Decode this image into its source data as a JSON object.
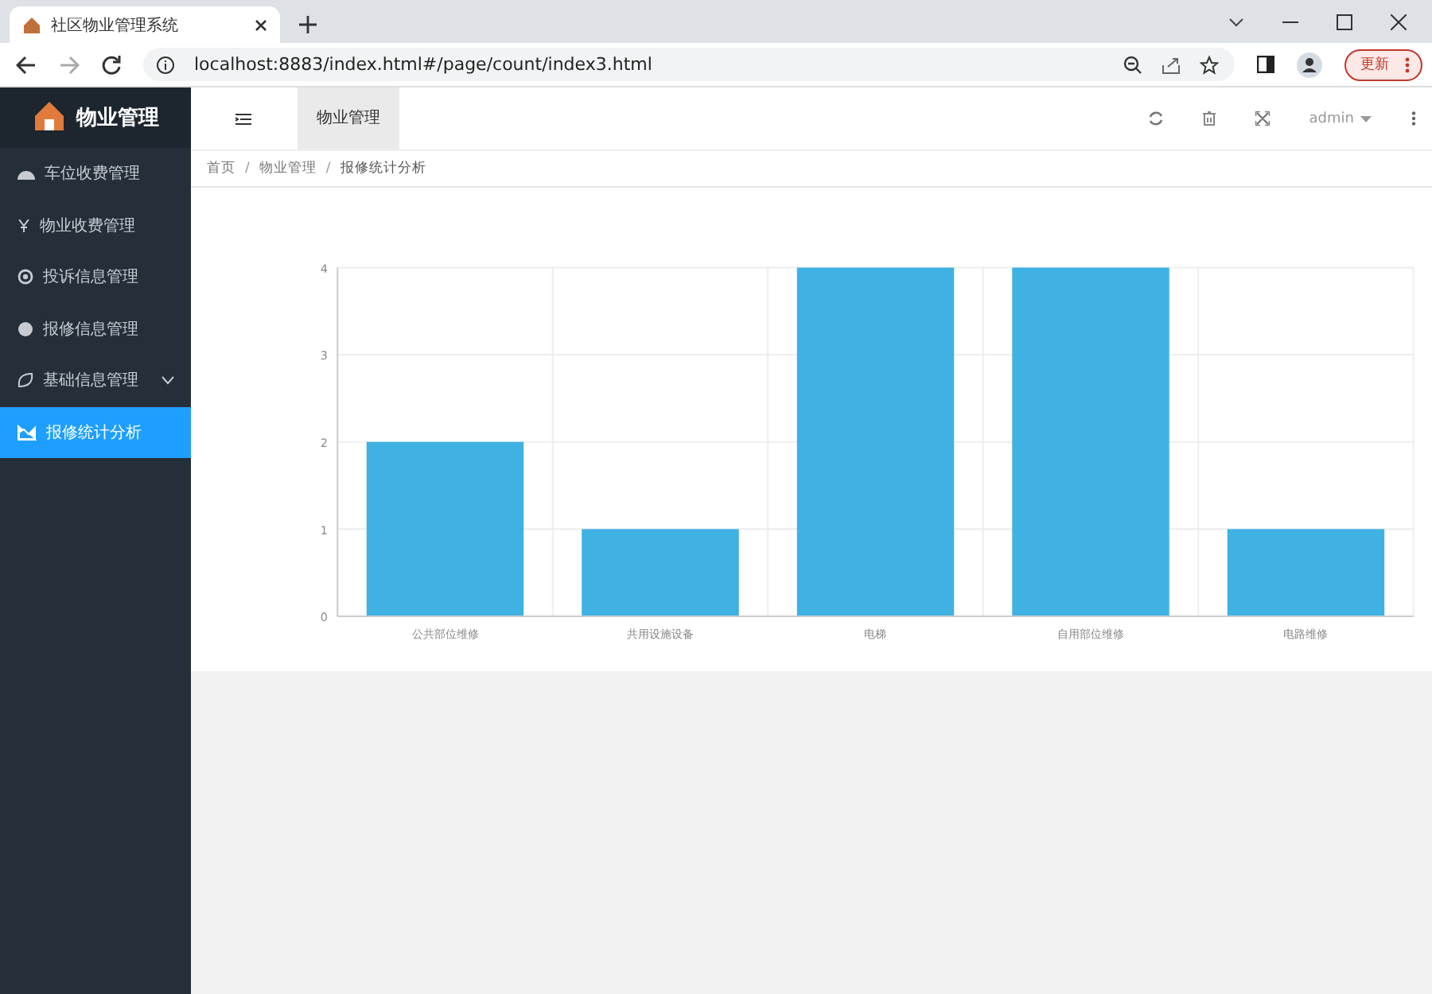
{
  "browser": {
    "tab_title": "社区物业管理系统",
    "url": "localhost:8883/index.html#/page/count/index3.html",
    "update_button": "更新"
  },
  "sidebar": {
    "logo": "物业管理",
    "items": [
      {
        "label": "车位收费管理",
        "selected": false
      },
      {
        "label": "物业收费管理",
        "selected": false
      },
      {
        "label": "投诉信息管理",
        "selected": false
      },
      {
        "label": "报修信息管理",
        "selected": false
      },
      {
        "label": "基础信息管理",
        "selected": false,
        "expanded": false
      },
      {
        "label": "报修统计分析",
        "selected": true
      }
    ]
  },
  "header": {
    "tabs": [
      {
        "label": "物业管理",
        "selected": true
      }
    ],
    "user": "admin"
  },
  "breadcrumb": {
    "separator": "/",
    "items": [
      "首页",
      "物业管理",
      "报修统计分析"
    ]
  },
  "chart_data": {
    "type": "bar",
    "categories": [
      "公共部位维修",
      "共用设施设备",
      "电梯",
      "自用部位维修",
      "电路维修"
    ],
    "series": [
      {
        "color": "#3fb1e3",
        "values": [
          2,
          1,
          4,
          4,
          1
        ]
      }
    ],
    "ylim": [
      0,
      4
    ],
    "yticks": [
      0,
      1,
      2,
      3,
      4
    ],
    "grid": true
  }
}
